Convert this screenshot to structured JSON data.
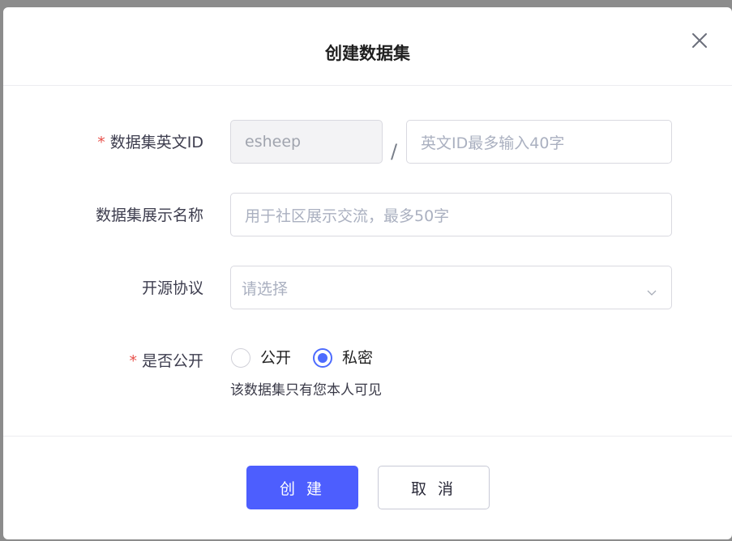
{
  "dialog": {
    "title": "创建数据集",
    "close_icon": "close-icon"
  },
  "form": {
    "dataset_id": {
      "required_mark": "*",
      "label": "数据集英文ID",
      "namespace_value": "esheep",
      "separator": "/",
      "id_placeholder": "英文ID最多输入40字"
    },
    "display_name": {
      "label": "数据集展示名称",
      "placeholder": "用于社区展示交流，最多50字"
    },
    "license": {
      "label": "开源协议",
      "placeholder": "请选择",
      "dropdown_icon": "chevron-down-icon"
    },
    "visibility": {
      "required_mark": "*",
      "label": "是否公开",
      "options": [
        {
          "label": "公开",
          "checked": false
        },
        {
          "label": "私密",
          "checked": true
        }
      ],
      "hint": "该数据集只有您本人可见"
    }
  },
  "footer": {
    "create_label": "创 建",
    "cancel_label": "取 消"
  },
  "colors": {
    "primary": "#4d5efe",
    "required": "#e8514b",
    "overlay": "#8c8c8c"
  }
}
